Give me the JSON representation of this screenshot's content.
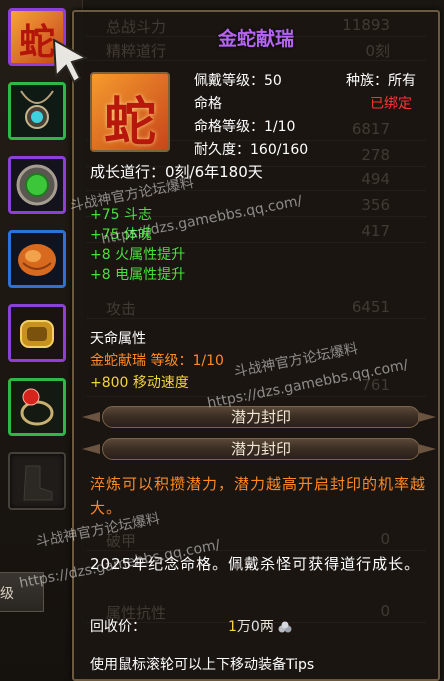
{
  "item": {
    "name": "金蛇献瑞",
    "icon_glyph": "蛇",
    "slot_icon_glyph": "蛇",
    "stats_header": {
      "wear_level": "佩戴等级：50",
      "race": "种族：所有",
      "category": "命格",
      "bound": "已绑定",
      "fate_level": "命格等级：1/10",
      "durability": "耐久度：160/160"
    },
    "growth": "成长道行：0刻/6年180天",
    "base_attrs": [
      "+75  斗志",
      "+75  体魄",
      "+8   火属性提升",
      "+8   电属性提升"
    ],
    "fate_section": {
      "header": "天命属性",
      "name_level": "金蛇献瑞  等级：1/10",
      "bonus": "+800  移动速度"
    },
    "seal_labels": [
      "潜力封印",
      "潜力封印"
    ],
    "refine_note": "淬炼可以积攒潜力，潜力越高开启封印的机率越大。",
    "desc": "2025年纪念命格。佩戴杀怪可获得道行成长。",
    "recycle": {
      "label": "回收价：",
      "gold": "1",
      "gold_unit": "万",
      "silver": "0",
      "silver_unit": "两"
    },
    "tip": "使用鼠标滚轮可以上下移动装备Tips"
  },
  "background_stats": [
    {
      "label": "总战斗力",
      "value": "11893"
    },
    {
      "label": "精粹道行",
      "value": "0刻"
    },
    {
      "label": "",
      "value": "6817"
    },
    {
      "label": "",
      "value": "278"
    },
    {
      "label": "",
      "value": "494"
    },
    {
      "label": "",
      "value": "356"
    },
    {
      "label": "",
      "value": "417"
    },
    {
      "label": "攻击",
      "value": "6451"
    },
    {
      "label": "",
      "value": "761"
    },
    {
      "label": "破甲",
      "value": "0"
    },
    {
      "label": "属性抗性",
      "value": "0"
    }
  ],
  "left_tab_label": "级",
  "watermark": {
    "line1": "斗战神官方论坛爆料",
    "url": "https://dzs.gamebbs.qq.com/"
  },
  "colors": {
    "title": "#b564f2",
    "green_attr": "#49e03f",
    "orange_text": "#ff8a24",
    "yellow_text": "#f3d43a",
    "bound_red": "#ff3333"
  }
}
